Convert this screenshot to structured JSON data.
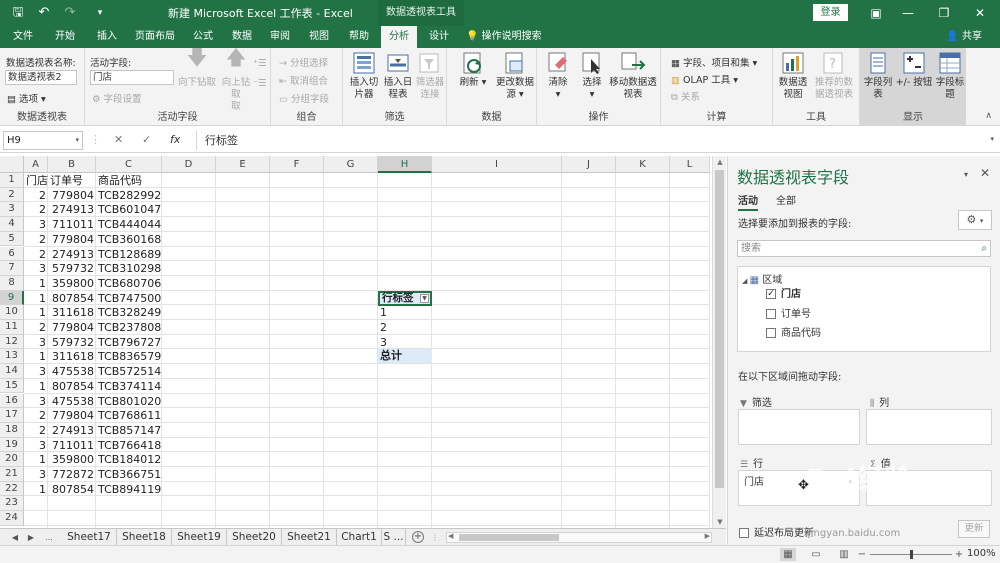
{
  "titlebar": {
    "title": "新建 Microsoft Excel 工作表  -  Excel",
    "context": "数据透视表工具",
    "login": "登录"
  },
  "tabs": [
    "文件",
    "开始",
    "插入",
    "页面布局",
    "公式",
    "数据",
    "审阅",
    "视图",
    "帮助",
    "分析",
    "设计"
  ],
  "tell_me": "操作说明搜索",
  "share": "共享",
  "ribbon": {
    "pivot_name_label": "数据透视表名称:",
    "pivot_name_value": "数据透视表2",
    "options": "选项",
    "group_pivot": "数据透视表",
    "active_field_label": "活动字段:",
    "active_field_value": "门店",
    "field_settings": "字段设置",
    "drill_down": "向下钻取",
    "drill_up": "向上钻取",
    "drill_up_2": "取",
    "group_active_field": "活动字段",
    "group_selection": "分组选择",
    "ungroup": "取消组合",
    "group_field": "分组字段",
    "group_group": "组合",
    "insert_slicer": "插入切片器",
    "insert_timeline": "插入日程表",
    "filter_connections": "筛选器连接",
    "group_filter": "筛选",
    "refresh": "刷新",
    "change_source": "更改数据源",
    "group_data": "数据",
    "clear": "清除",
    "select": "选择",
    "move_pivot": "移动数据透视表",
    "group_actions": "操作",
    "fields_items": "字段、项目和集",
    "olap_tools": "OLAP 工具",
    "relationships": "关系",
    "group_calc": "计算",
    "pivot_chart": "数据透视图",
    "recommended": "推荐的数据透视表",
    "group_tools": "工具",
    "field_list": "字段列表",
    "plus_minus": "+/- 按钮",
    "field_headers": "字段标题",
    "group_show": "显示"
  },
  "formula": {
    "namebox": "H9",
    "cancel": "✕",
    "enter": "✓",
    "fx": "fx",
    "content": "行标签"
  },
  "columns": [
    "A",
    "B",
    "C",
    "D",
    "E",
    "F",
    "G",
    "H",
    "I",
    "J",
    "K",
    "L"
  ],
  "rows": [
    "1",
    "2",
    "3",
    "4",
    "5",
    "6",
    "7",
    "8",
    "9",
    "10",
    "11",
    "12",
    "13",
    "14",
    "15",
    "16",
    "17",
    "18",
    "19",
    "20",
    "21",
    "22",
    "23",
    "24"
  ],
  "table_header": [
    "门店",
    "订单号",
    "商品代码"
  ],
  "table_rows": [
    [
      "2",
      "779804",
      "TCB282992"
    ],
    [
      "2",
      "274913",
      "TCB601047"
    ],
    [
      "3",
      "711011",
      "TCB444044"
    ],
    [
      "2",
      "779804",
      "TCB360168"
    ],
    [
      "2",
      "274913",
      "TCB128689"
    ],
    [
      "3",
      "579732",
      "TCB310298"
    ],
    [
      "1",
      "359800",
      "TCB680706"
    ],
    [
      "1",
      "807854",
      "TCB747500"
    ],
    [
      "1",
      "311618",
      "TCB328249"
    ],
    [
      "2",
      "779804",
      "TCB237808"
    ],
    [
      "3",
      "579732",
      "TCB796727"
    ],
    [
      "1",
      "311618",
      "TCB836579"
    ],
    [
      "3",
      "475538",
      "TCB572514"
    ],
    [
      "1",
      "807854",
      "TCB374114"
    ],
    [
      "3",
      "475538",
      "TCB801020"
    ],
    [
      "2",
      "779804",
      "TCB768611"
    ],
    [
      "2",
      "274913",
      "TCB857147"
    ],
    [
      "3",
      "711011",
      "TCB766418"
    ],
    [
      "1",
      "359800",
      "TCB184012"
    ],
    [
      "3",
      "772872",
      "TCB366751"
    ],
    [
      "1",
      "807854",
      "TCB894119"
    ]
  ],
  "pivot": {
    "header": "行标签",
    "items": [
      "1",
      "2",
      "3"
    ],
    "total": "总计"
  },
  "sheets": [
    "Sheet17",
    "Sheet18",
    "Sheet19",
    "Sheet20",
    "Sheet21",
    "Chart1",
    "S ..."
  ],
  "sheet_nav": [
    "◀",
    "▶",
    "..."
  ],
  "status": {
    "zoom": "100%",
    "minus": "−",
    "plus": "+"
  },
  "pane": {
    "title": "数据透视表字段",
    "tab_active": "活动",
    "tab_all": "全部",
    "choose_label": "选择要添加到报表的字段:",
    "search_placeholder": "搜索",
    "area_name": "区域",
    "fields": [
      {
        "name": "门店",
        "checked": true
      },
      {
        "name": "订单号",
        "checked": false
      },
      {
        "name": "商品代码",
        "checked": false
      }
    ],
    "drag_msg": "在以下区域间拖动字段:",
    "filter_label": "筛选",
    "columns_label": "列",
    "rows_label": "行",
    "values_label": "值",
    "row_field": "门店",
    "defer_label": "延迟布局更新",
    "update": "更新"
  },
  "watermark": {
    "logo": "Bai经验",
    "url": "jingyan.baidu.com"
  },
  "colors": {
    "excel_green": "#217346",
    "pivot_blue": "#dcebf7"
  }
}
